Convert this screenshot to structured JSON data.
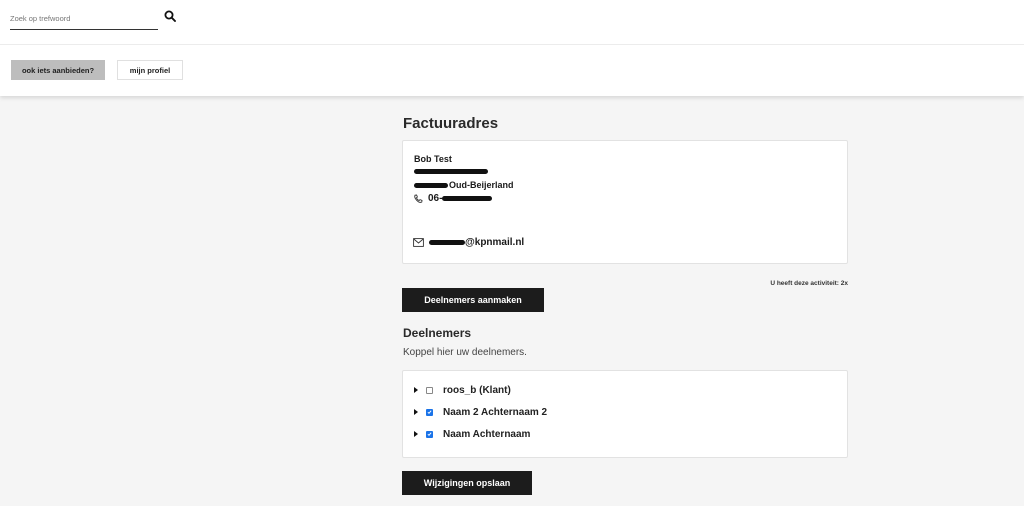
{
  "header": {
    "search": {
      "placeholder": "Zoek op trefwoord",
      "value": ""
    },
    "search_icon": "search-icon",
    "buttons": {
      "offer": "ook iets aanbieden?",
      "profile": "mijn profiel"
    }
  },
  "billing": {
    "title": "Factuuradres",
    "name": "Bob Test",
    "city_suffix": "Oud-Beijerland",
    "phone_prefix": "06-",
    "email_suffix": "@kpnmail.nl",
    "phone_icon": "phone-icon",
    "mail_icon": "mail-icon"
  },
  "activity_text": "U heeft deze activiteit: 2x",
  "actions": {
    "create": "Deelnemers aanmaken",
    "save": "Wijzigingen opslaan"
  },
  "participants": {
    "title": "Deelnemers",
    "subtitle": "Koppel hier uw deelnemers.",
    "items": [
      {
        "label": "roos_b (Klant)",
        "checked": false
      },
      {
        "label": "Naam 2 Achternaam 2",
        "checked": true
      },
      {
        "label": "Naam Achternaam",
        "checked": true
      }
    ]
  },
  "colors": {
    "checkbox_checked": "#1a73e8",
    "dark_button": "#1c1c1c",
    "offer_button": "#bdbdbd"
  }
}
